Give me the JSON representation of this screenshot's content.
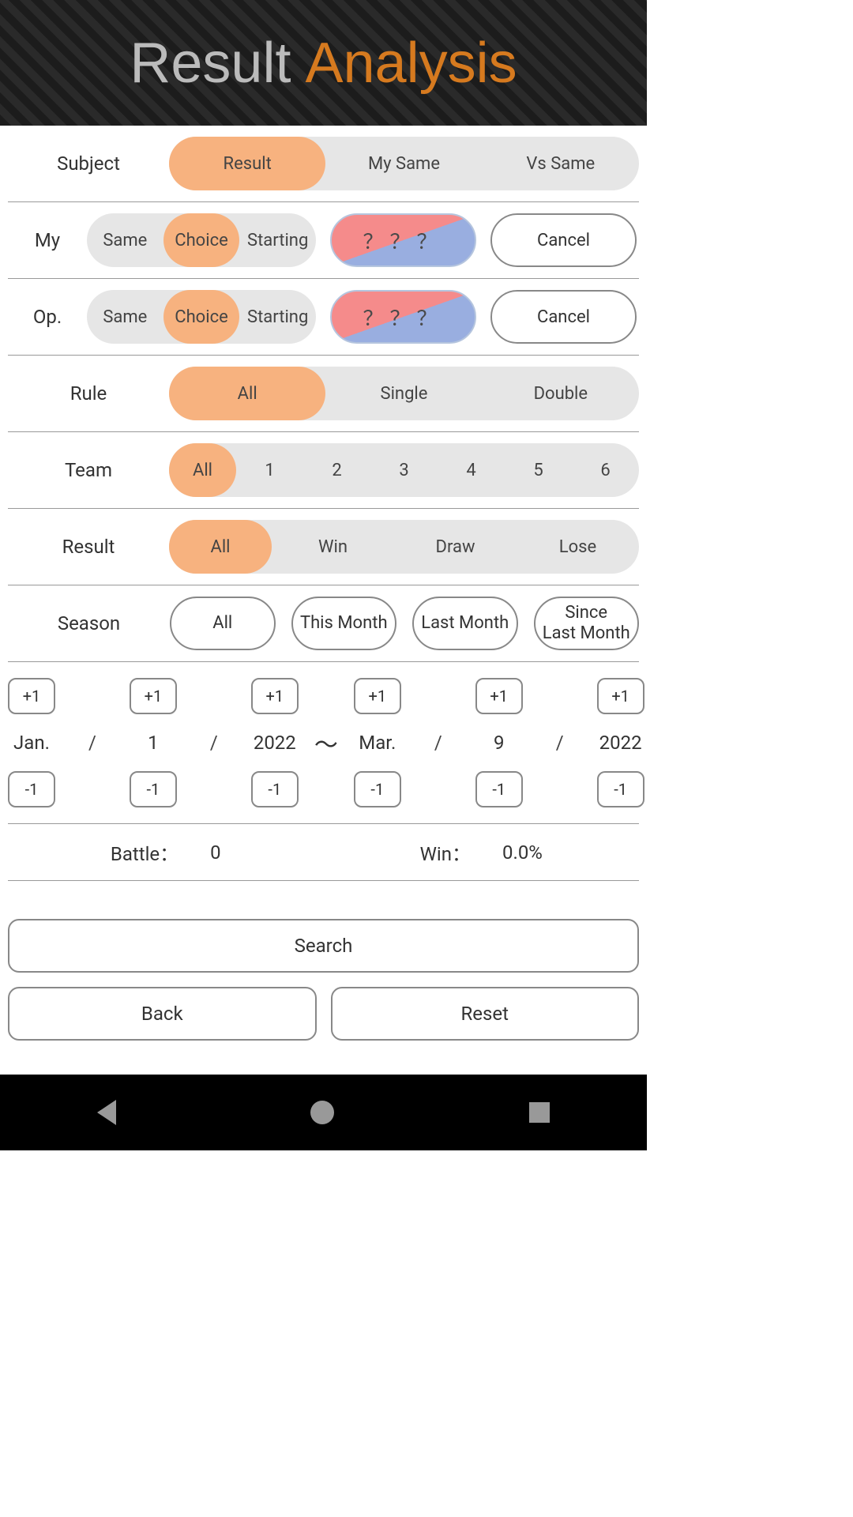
{
  "header": {
    "title_1": "Result",
    "title_2": "Analysis"
  },
  "subject": {
    "label": "Subject",
    "options": [
      "Result",
      "My Same",
      "Vs Same"
    ],
    "active": 0
  },
  "my": {
    "label": "My",
    "options": [
      "Same",
      "Choice",
      "Starting"
    ],
    "active": 1,
    "indicator": "？？？",
    "cancel": "Cancel"
  },
  "op": {
    "label": "Op.",
    "options": [
      "Same",
      "Choice",
      "Starting"
    ],
    "active": 1,
    "indicator": "？？？",
    "cancel": "Cancel"
  },
  "rule": {
    "label": "Rule",
    "options": [
      "All",
      "Single",
      "Double"
    ],
    "active": 0
  },
  "team": {
    "label": "Team",
    "options": [
      "All",
      "1",
      "2",
      "3",
      "4",
      "5",
      "6"
    ],
    "active": 0
  },
  "result": {
    "label": "Result",
    "options": [
      "All",
      "Win",
      "Draw",
      "Lose"
    ],
    "active": 0
  },
  "season": {
    "label": "Season",
    "options": [
      "All",
      "This Month",
      "Last Month",
      "Since\nLast Month"
    ]
  },
  "date": {
    "plus": "+1",
    "minus": "-1",
    "from": {
      "month": "Jan.",
      "day": "1",
      "year": "2022"
    },
    "to": {
      "month": "Mar.",
      "day": "9",
      "year": "2022"
    },
    "sep": "/",
    "tilde": "〜"
  },
  "stats": {
    "battle_label": "Battle：",
    "battle_value": "0",
    "win_label": "Win：",
    "win_value": "0.0%"
  },
  "buttons": {
    "search": "Search",
    "back": "Back",
    "reset": "Reset"
  }
}
